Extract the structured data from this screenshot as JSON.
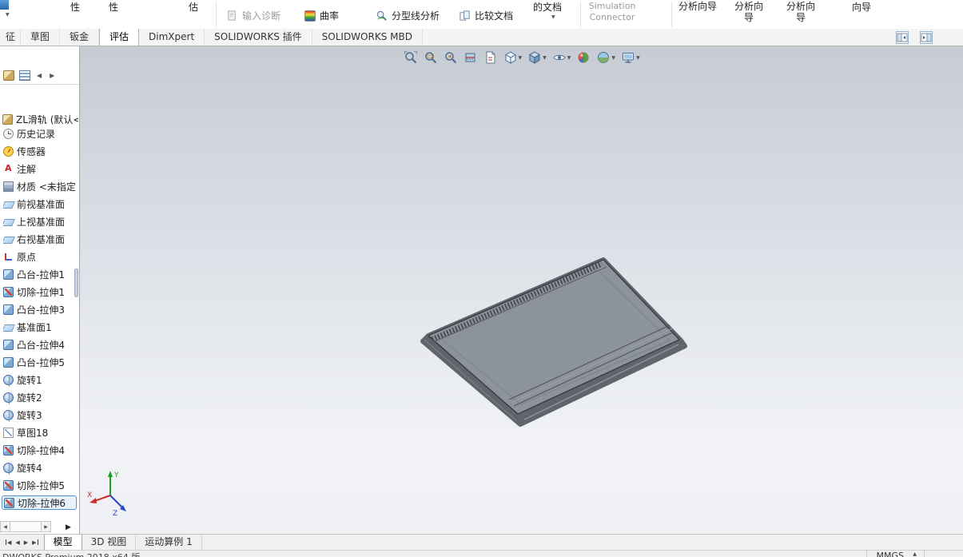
{
  "app": {
    "status_left": "DWORKS Premium 2018 x64 版",
    "units_label": "MMGS"
  },
  "ribbon": {
    "partials": [
      "性",
      "性",
      "估",
      "的文档",
      "向导"
    ],
    "buttons": [
      {
        "label": "输入诊断",
        "icon": "import-diagnostics-icon",
        "enabled": false
      },
      {
        "label": "曲率",
        "icon": "curvature-icon",
        "enabled": true
      },
      {
        "label": "分型线分析",
        "icon": "parting-line-analysis-icon",
        "enabled": true
      },
      {
        "label": "比较文档",
        "icon": "compare-documents-icon",
        "enabled": true
      },
      {
        "label": "Simulation Connector",
        "icon": "simulation-connector-icon",
        "enabled": false
      },
      {
        "label": "分析向导",
        "enabled": true
      },
      {
        "label": "分析向\n导",
        "enabled": true
      },
      {
        "label": "分析向\n导",
        "enabled": true
      }
    ]
  },
  "command_tabs": [
    {
      "label": "征",
      "active": false
    },
    {
      "label": "草图",
      "active": false
    },
    {
      "label": "钣金",
      "active": false
    },
    {
      "label": "评估",
      "active": true
    },
    {
      "label": "DimXpert",
      "active": false
    },
    {
      "label": "SOLIDWORKS 插件",
      "active": false
    },
    {
      "label": "SOLIDWORKS MBD",
      "active": false
    }
  ],
  "feature_panel": {
    "tabs": [
      "featuremanager-tree-tab",
      "displaymanager-tab"
    ],
    "root_label": "ZL滑轨 (默认<<!",
    "items": [
      {
        "label": "历史记录",
        "icon": "history-folder-icon"
      },
      {
        "label": "传感器",
        "icon": "sensors-folder-icon"
      },
      {
        "label": "注解",
        "icon": "annotations-folder-icon"
      },
      {
        "label": "材质 <未指定",
        "icon": "material-icon"
      },
      {
        "label": "前视基准面",
        "icon": "plane-icon"
      },
      {
        "label": "上视基准面",
        "icon": "plane-icon"
      },
      {
        "label": "右视基准面",
        "icon": "plane-icon"
      },
      {
        "label": "原点",
        "icon": "origin-icon"
      },
      {
        "label": "凸台-拉伸1",
        "icon": "boss-extrude-icon"
      },
      {
        "label": "切除-拉伸1",
        "icon": "cut-extrude-icon"
      },
      {
        "label": "凸台-拉伸3",
        "icon": "boss-extrude-icon"
      },
      {
        "label": "基准面1",
        "icon": "plane-icon"
      },
      {
        "label": "凸台-拉伸4",
        "icon": "boss-extrude-icon"
      },
      {
        "label": "凸台-拉伸5",
        "icon": "boss-extrude-icon"
      },
      {
        "label": "旋转1",
        "icon": "revolve-icon"
      },
      {
        "label": "旋转2",
        "icon": "revolve-icon"
      },
      {
        "label": "旋转3",
        "icon": "revolve-icon"
      },
      {
        "label": "草图18",
        "icon": "sketch-icon"
      },
      {
        "label": "切除-拉伸4",
        "icon": "cut-extrude-icon"
      },
      {
        "label": "旋转4",
        "icon": "revolve-icon"
      },
      {
        "label": "切除-拉伸5",
        "icon": "cut-extrude-icon"
      },
      {
        "label": "切除-拉伸6",
        "icon": "cut-extrude-icon",
        "selected": true
      }
    ]
  },
  "viewport": {
    "toolbar": [
      {
        "name": "zoom-to-fit-icon",
        "caret": false
      },
      {
        "name": "zoom-to-area-icon",
        "caret": false
      },
      {
        "name": "previous-view-icon",
        "caret": false
      },
      {
        "name": "section-view-icon",
        "caret": false
      },
      {
        "name": "annotation-view-icon",
        "caret": false
      },
      {
        "name": "view-orientation-icon",
        "caret": true
      },
      {
        "name": "display-style-icon",
        "caret": true
      },
      {
        "name": "hide-show-items-icon",
        "caret": true
      },
      {
        "name": "edit-appearance-icon",
        "caret": false
      },
      {
        "name": "apply-scene-icon",
        "caret": true
      },
      {
        "name": "view-settings-icon",
        "caret": true
      }
    ],
    "triad": {
      "x": "X",
      "y": "Y",
      "z": "Z"
    },
    "model": "flat-rail-plate"
  },
  "document_tabs": [
    {
      "label": "模型",
      "active": true
    },
    {
      "label": "3D 视图",
      "active": false
    },
    {
      "label": "运动算例 1",
      "active": false
    }
  ],
  "colors": {
    "selection_blue": "#4f94d6",
    "viewport_top": "#c6cbd4",
    "viewport_bottom": "#f1f3f6",
    "model_face": "#8d939b"
  }
}
